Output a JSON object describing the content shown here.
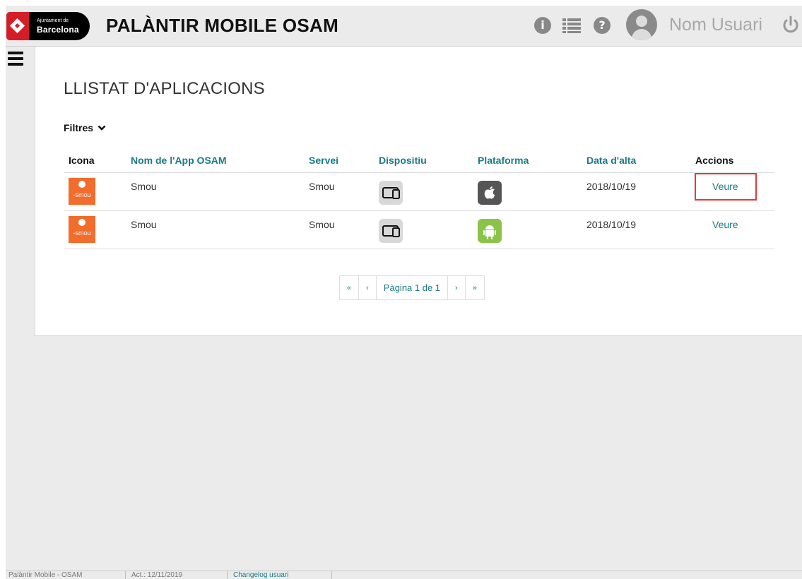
{
  "header": {
    "logo_small": "Ajuntament de",
    "logo_big": "Barcelona",
    "title": "PALÀNTIR MOBILE OSAM",
    "user_name": "Nom Usuari",
    "icons": [
      "info-icon",
      "list-icon",
      "help-icon",
      "user-avatar-icon",
      "power-icon"
    ]
  },
  "page": {
    "title": "LLISTAT D'APLICACIONS",
    "filters_label": "Filtres"
  },
  "table": {
    "headers": [
      "Icona",
      "Nom de l'App OSAM",
      "Servei",
      "Dispositiu",
      "Plataforma",
      "Data d'alta",
      "Accions"
    ],
    "rows": [
      {
        "icon_text": "smou",
        "name": "Smou",
        "service": "Smou",
        "device": "tablet-phone-icon",
        "platform": "apple-icon",
        "date": "2018/10/19",
        "action": "Veure"
      },
      {
        "icon_text": "smou",
        "name": "Smou",
        "service": "Smou",
        "device": "tablet-phone-icon",
        "platform": "android-icon",
        "date": "2018/10/19",
        "action": "Veure"
      }
    ]
  },
  "pagination": {
    "first": "«",
    "prev": "‹",
    "label": "Pàgina 1 de 1",
    "next": "›",
    "last": "»"
  },
  "footer": {
    "app": "Palàntir Mobile - OSAM",
    "updated": "Act.: 12/11/2019",
    "changelog": "Changelog usuari"
  },
  "colors": {
    "accent": "#1a7a86",
    "brand_red": "#d51d28",
    "app_orange": "#f26c2b",
    "android_green": "#8bc34a",
    "highlight_red": "#e53935"
  }
}
